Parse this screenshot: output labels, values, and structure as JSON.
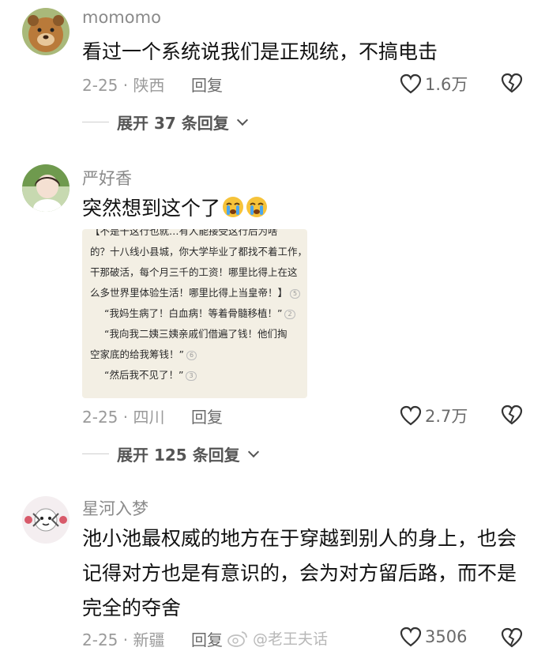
{
  "comments": [
    {
      "username": "momomo",
      "text": "看过一个系统说我们是正规统，不搞电击",
      "date": "2-25",
      "location": "陕西",
      "reply_label": "回复",
      "likes": "1.6万",
      "expand": {
        "prefix": "展开",
        "count": "37",
        "suffix": "条回复"
      }
    },
    {
      "username": "严好香",
      "text": "突然想到这个了",
      "emoji": [
        "crying-face-icon",
        "crying-face-icon"
      ],
      "date": "2-25",
      "location": "四川",
      "reply_label": "回复",
      "likes": "2.7万",
      "expand": {
        "prefix": "展开",
        "count": "125",
        "suffix": "条回复"
      },
      "image_lines": [
        "【不是干这行也就…有人能接受这行后为啥",
        "的？十八线小县城，你大学毕业了都找不着工作，",
        "干那破活，每个月三千的工资！哪里比得上在这",
        "么多世界里体验生活！哪里比得上当皇帝！】",
        "“我妈生病了！白血病！等着骨髓移植！”",
        "“我向我二姨三姨亲戚们借遍了钱！他们掏",
        "空家底的给我筹钱！”",
        "“然后我不见了！”"
      ],
      "image_counts": [
        "5",
        "2",
        "6",
        "3"
      ]
    },
    {
      "username": "星河入梦",
      "text": "池小池最权威的地方在于穿越到别人的身上，也会记得对方也是有意识的，会为对方留后路，而不是完全的夺舍",
      "date": "2-25",
      "location": "新疆",
      "reply_label": "回复",
      "likes": "3506"
    }
  ],
  "watermark": "@老王夫话"
}
